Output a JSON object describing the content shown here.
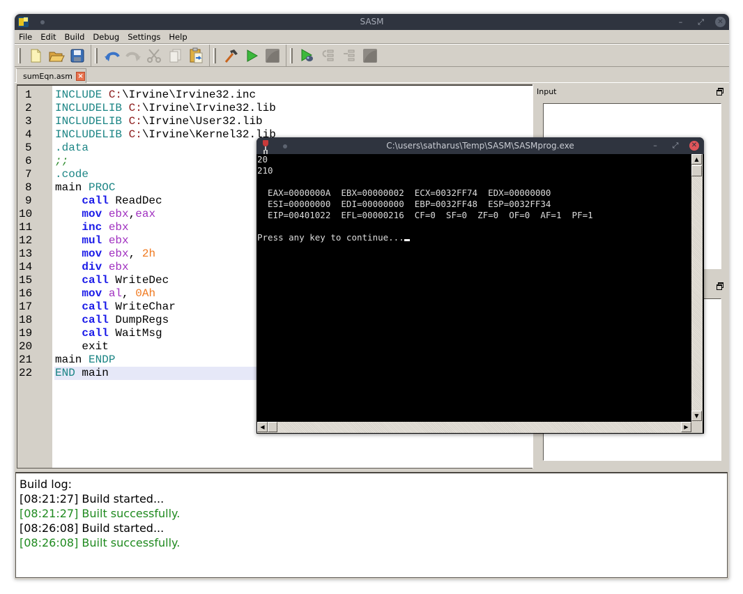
{
  "window": {
    "title": "SASM"
  },
  "menu": [
    "File",
    "Edit",
    "Build",
    "Debug",
    "Settings",
    "Help"
  ],
  "toolbar": {
    "groups": [
      [
        "new-file",
        "open-file",
        "save-file"
      ],
      [
        "undo",
        "redo",
        "cut",
        "copy",
        "paste"
      ],
      [
        "build",
        "run",
        "stop"
      ],
      [
        "debug",
        "step-over",
        "step-into",
        "stop-debug"
      ]
    ]
  },
  "tabs": [
    {
      "label": "sumEqn.asm",
      "close": "×"
    }
  ],
  "editor": {
    "lines": [
      {
        "n": "1",
        "tokens": [
          [
            "INCLUDE ",
            "dir"
          ],
          [
            "C:",
            "path"
          ],
          [
            "\\Irvine\\Irvine32.inc",
            "plain"
          ]
        ]
      },
      {
        "n": "2",
        "tokens": [
          [
            "INCLUDELIB ",
            "dir"
          ],
          [
            "C:",
            "path"
          ],
          [
            "\\Irvine\\Irvine32.lib",
            "plain"
          ]
        ]
      },
      {
        "n": "3",
        "tokens": [
          [
            "INCLUDELIB ",
            "dir"
          ],
          [
            "C:",
            "path"
          ],
          [
            "\\Irvine\\User32.lib",
            "plain"
          ]
        ]
      },
      {
        "n": "4",
        "tokens": [
          [
            "INCLUDELIB ",
            "dir"
          ],
          [
            "C:",
            "path"
          ],
          [
            "\\Irvine\\Kernel32.lib",
            "plain"
          ]
        ]
      },
      {
        "n": "5",
        "tokens": [
          [
            ".data",
            "dir"
          ]
        ]
      },
      {
        "n": "6",
        "tokens": [
          [
            ";;",
            "cmt"
          ]
        ]
      },
      {
        "n": "7",
        "tokens": [
          [
            ".code",
            "dir"
          ]
        ]
      },
      {
        "n": "8",
        "tokens": [
          [
            "main ",
            "plain"
          ],
          [
            "PROC",
            "dir"
          ]
        ]
      },
      {
        "n": "9",
        "tokens": [
          [
            "    ",
            "plain"
          ],
          [
            "call",
            "kw"
          ],
          [
            " ReadDec",
            "plain"
          ]
        ]
      },
      {
        "n": "10",
        "tokens": [
          [
            "    ",
            "plain"
          ],
          [
            "mov",
            "kw"
          ],
          [
            " ",
            "plain"
          ],
          [
            "ebx",
            "reg"
          ],
          [
            ",",
            "plain"
          ],
          [
            "eax",
            "reg"
          ]
        ]
      },
      {
        "n": "11",
        "tokens": [
          [
            "    ",
            "plain"
          ],
          [
            "inc",
            "kw"
          ],
          [
            " ",
            "plain"
          ],
          [
            "ebx",
            "reg"
          ]
        ]
      },
      {
        "n": "12",
        "tokens": [
          [
            "    ",
            "plain"
          ],
          [
            "mul",
            "kw"
          ],
          [
            " ",
            "plain"
          ],
          [
            "ebx",
            "reg"
          ]
        ]
      },
      {
        "n": "13",
        "tokens": [
          [
            "    ",
            "plain"
          ],
          [
            "mov",
            "kw"
          ],
          [
            " ",
            "plain"
          ],
          [
            "ebx",
            "reg"
          ],
          [
            ", ",
            "plain"
          ],
          [
            "2h",
            "num"
          ]
        ]
      },
      {
        "n": "14",
        "tokens": [
          [
            "    ",
            "plain"
          ],
          [
            "div",
            "kw"
          ],
          [
            " ",
            "plain"
          ],
          [
            "ebx",
            "reg"
          ]
        ]
      },
      {
        "n": "15",
        "tokens": [
          [
            "    ",
            "plain"
          ],
          [
            "call",
            "kw"
          ],
          [
            " WriteDec",
            "plain"
          ]
        ]
      },
      {
        "n": "16",
        "tokens": [
          [
            "    ",
            "plain"
          ],
          [
            "mov",
            "kw"
          ],
          [
            " ",
            "plain"
          ],
          [
            "al",
            "reg"
          ],
          [
            ", ",
            "plain"
          ],
          [
            "0Ah",
            "num"
          ]
        ]
      },
      {
        "n": "17",
        "tokens": [
          [
            "    ",
            "plain"
          ],
          [
            "call",
            "kw"
          ],
          [
            " WriteChar",
            "plain"
          ]
        ]
      },
      {
        "n": "18",
        "tokens": [
          [
            "    ",
            "plain"
          ],
          [
            "call",
            "kw"
          ],
          [
            " DumpRegs",
            "plain"
          ]
        ]
      },
      {
        "n": "19",
        "tokens": [
          [
            "    ",
            "plain"
          ],
          [
            "call",
            "kw"
          ],
          [
            " WaitMsg",
            "plain"
          ]
        ]
      },
      {
        "n": "20",
        "tokens": [
          [
            "    exit",
            "plain"
          ]
        ]
      },
      {
        "n": "21",
        "tokens": [
          [
            "main ",
            "plain"
          ],
          [
            "ENDP",
            "dir"
          ]
        ]
      },
      {
        "n": "22",
        "tokens": [
          [
            "END",
            "dir"
          ],
          [
            " main",
            "plain"
          ]
        ],
        "current": true
      }
    ]
  },
  "dock": {
    "input_title": "Input",
    "input_value": "",
    "output_title": "",
    "output_value": ""
  },
  "build_log": {
    "header": "Build log:",
    "entries": [
      {
        "text": "[08:21:27] Build started...",
        "status": "info"
      },
      {
        "text": "[08:21:27] Built successfully.",
        "status": "ok"
      },
      {
        "text": "[08:26:08] Build started...",
        "status": "info"
      },
      {
        "text": "[08:26:08] Built successfully.",
        "status": "ok"
      }
    ]
  },
  "console": {
    "title": "C:\\users\\satharus\\Temp\\SASM\\SASMprog.exe",
    "lines": [
      "20",
      "210",
      "",
      "  EAX=0000000A  EBX=00000002  ECX=0032FF74  EDX=00000000",
      "  ESI=00000000  EDI=00000000  EBP=0032FF48  ESP=0032FF34",
      "  EIP=00401022  EFL=00000216  CF=0  SF=0  ZF=0  OF=0  AF=1  PF=1",
      "",
      "Press any key to continue..."
    ]
  },
  "colors": {
    "titlebar": "#2f343f",
    "chrome": "#d4d0c8",
    "success": "#1f8a1f",
    "directive": "#1c8585",
    "keyword": "#1a1ae8",
    "register": "#a030c0",
    "number": "#f07a20"
  }
}
